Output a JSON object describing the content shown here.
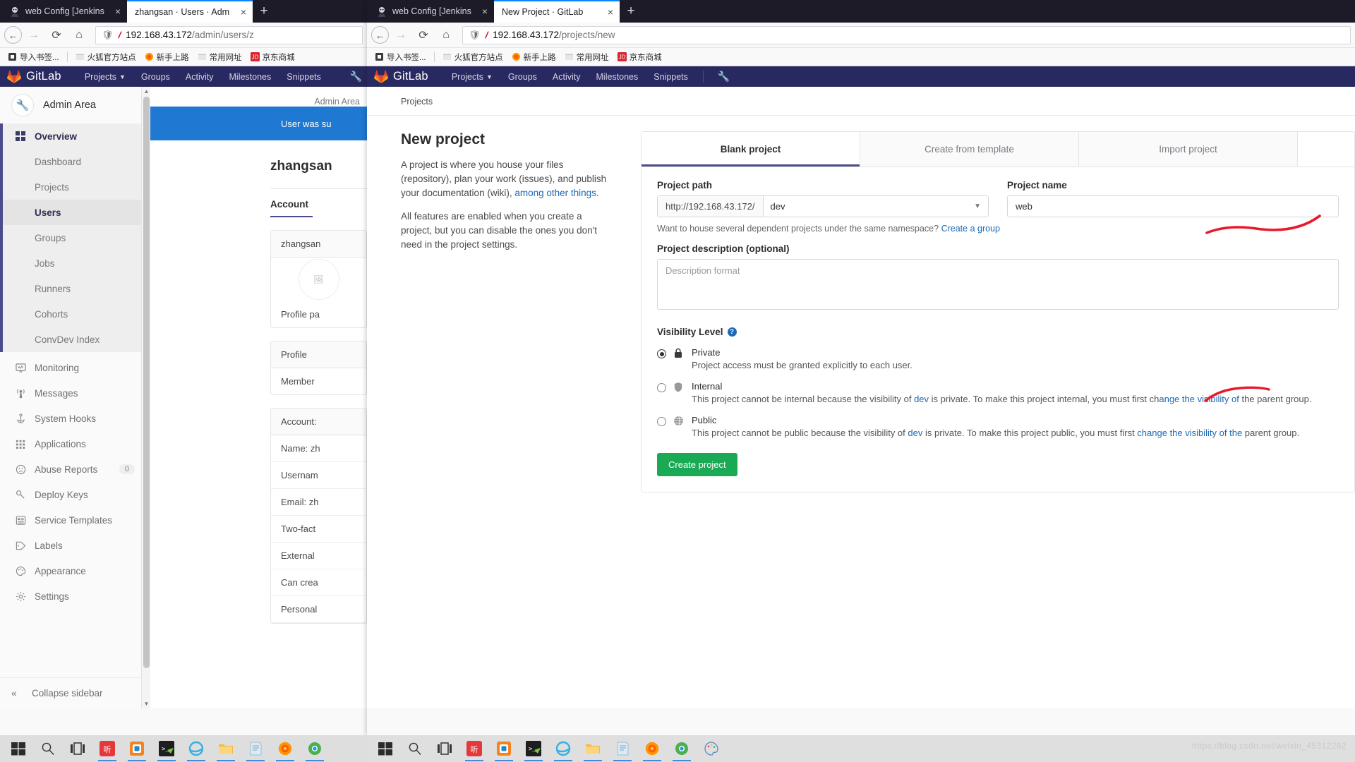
{
  "window1": {
    "tabs": [
      {
        "label": "web Config [Jenkins]",
        "favicon": "jenkins-icon",
        "active": false,
        "close": "×"
      },
      {
        "label": "zhangsan · Users · Admin Area · G",
        "favicon": "gitlab-icon",
        "active": true,
        "close": "×"
      }
    ],
    "newtab_label": "+",
    "url": "192.168.43.172",
    "url_path": "/admin/users/z",
    "nav": {
      "back": "←",
      "forward": "→",
      "reload": "⟳",
      "home": "⌂"
    },
    "bookmarks": [
      {
        "label": "导入书签...",
        "icon": "import-bookmarks-icon"
      },
      {
        "label": "火狐官方站点",
        "icon": "folder-icon"
      },
      {
        "label": "新手上路",
        "icon": "firefox-icon"
      },
      {
        "label": "常用网址",
        "icon": "folder-icon"
      },
      {
        "label": "京东商城",
        "icon": "jd-icon"
      }
    ],
    "gitlab_nav": {
      "brand": "GitLab",
      "items": [
        "Projects",
        "Groups",
        "Activity",
        "Milestones",
        "Snippets"
      ],
      "wrench": "wrench-icon"
    },
    "sidebar": {
      "title": "Admin Area",
      "avatar_icon": "wrench-icon",
      "overview": {
        "label": "Overview",
        "icon": "grid-icon"
      },
      "sub_items": [
        {
          "label": "Dashboard",
          "active": false
        },
        {
          "label": "Projects",
          "active": false
        },
        {
          "label": "Users",
          "active": true
        },
        {
          "label": "Groups",
          "active": false
        },
        {
          "label": "Jobs",
          "active": false
        },
        {
          "label": "Runners",
          "active": false
        },
        {
          "label": "Cohorts",
          "active": false
        },
        {
          "label": "ConvDev Index",
          "active": false
        }
      ],
      "items": [
        {
          "label": "Monitoring",
          "icon": "monitor-icon",
          "badge": ""
        },
        {
          "label": "Messages",
          "icon": "broadcast-icon",
          "badge": ""
        },
        {
          "label": "System Hooks",
          "icon": "hook-icon",
          "badge": ""
        },
        {
          "label": "Applications",
          "icon": "apps-icon",
          "badge": ""
        },
        {
          "label": "Abuse Reports",
          "icon": "frown-icon",
          "badge": "0"
        },
        {
          "label": "Deploy Keys",
          "icon": "key-icon",
          "badge": ""
        },
        {
          "label": "Service Templates",
          "icon": "template-icon",
          "badge": ""
        },
        {
          "label": "Labels",
          "icon": "label-icon",
          "badge": ""
        },
        {
          "label": "Appearance",
          "icon": "appearance-icon",
          "badge": ""
        },
        {
          "label": "Settings",
          "icon": "gear-icon",
          "badge": ""
        }
      ],
      "collapse": {
        "label": "Collapse sidebar",
        "icon": "chevrons-left-icon"
      }
    },
    "page": {
      "breadcrumb": "Admin Area",
      "flash": "User was su",
      "title": "zhangsan",
      "tab": "Account",
      "card1_header": "zhangsan",
      "card1_footer": "Profile pa",
      "card2_rows": [
        "Profile",
        "Member"
      ],
      "card3_header": "Account:",
      "card3_rows": [
        "Name: zh",
        "Usernam",
        "Email: zh",
        "Two-fact",
        "External",
        "Can crea",
        "Personal"
      ]
    }
  },
  "window2": {
    "tabs": [
      {
        "label": "web Config [Jenkins]",
        "favicon": "jenkins-icon",
        "active": false,
        "close": "×"
      },
      {
        "label": "New Project · GitLab",
        "favicon": "gitlab-icon",
        "active": true,
        "close": "×"
      }
    ],
    "newtab_label": "+",
    "url": "192.168.43.172",
    "url_path": "/projects/new",
    "nav": {
      "back": "←",
      "forward": "→",
      "reload": "⟳",
      "home": "⌂"
    },
    "bookmarks": [
      {
        "label": "导入书签...",
        "icon": "import-bookmarks-icon"
      },
      {
        "label": "火狐官方站点",
        "icon": "folder-icon"
      },
      {
        "label": "新手上路",
        "icon": "firefox-icon"
      },
      {
        "label": "常用网址",
        "icon": "folder-icon"
      },
      {
        "label": "京东商城",
        "icon": "jd-icon"
      }
    ],
    "gitlab_nav": {
      "brand": "GitLab",
      "items": [
        "Projects",
        "Groups",
        "Activity",
        "Milestones",
        "Snippets"
      ],
      "wrench": "wrench-icon"
    },
    "page": {
      "breadcrumb": "Projects",
      "title": "New project",
      "intro_p1_a": "A project is where you house your files (repository), plan your work (issues), and publish your documentation (wiki), ",
      "intro_p1_link": "among other things",
      "intro_p1_b": ".",
      "intro_p2": "All features are enabled when you create a project, but you can disable the ones you don't need in the project settings.",
      "tabs": [
        {
          "label": "Blank project",
          "active": true
        },
        {
          "label": "Create from template",
          "active": false
        },
        {
          "label": "Import project",
          "active": false
        }
      ],
      "project_path": {
        "label": "Project path",
        "prefix": "http://192.168.43.172/",
        "value": "dev",
        "chevron": "chevron-down-icon"
      },
      "project_name": {
        "label": "Project name",
        "value": "web"
      },
      "namespace_hint_text": "Want to house several dependent projects under the same namespace? ",
      "namespace_hint_link": "Create a group",
      "description": {
        "label": "Project description (optional)",
        "placeholder": "Description format"
      },
      "visibility": {
        "label": "Visibility Level",
        "help": "?",
        "options": [
          {
            "name": "Private",
            "icon": "lock-icon",
            "selected": true,
            "desc_parts": [
              "Project access must be granted explicitly to each user."
            ]
          },
          {
            "name": "Internal",
            "icon": "shield-icon",
            "selected": false,
            "desc_parts": [
              "This project cannot be internal because the visibility of ",
              "dev",
              " is private. To make this project internal, you must first ch",
              "the parent group."
            ]
          },
          {
            "name": "Public",
            "icon": "globe-icon",
            "selected": false,
            "desc_parts": [
              "This project cannot be public because the visibility of ",
              "dev",
              " is private. To make this project public, you must first ",
              "chan",
              "parent group."
            ]
          }
        ]
      },
      "submit": "Create project"
    }
  },
  "taskbar": {
    "left": {
      "start": "windows-start-icon",
      "search": "search-icon",
      "taskview": "task-view-icon",
      "apps": [
        "kugou-icon",
        "wps-icon",
        "terminal-icon",
        "ie-icon",
        "explorer-icon",
        "notepad-icon",
        "firefox-icon",
        "chrome-icon"
      ]
    },
    "right": {
      "start": "windows-start-icon",
      "search": "search-icon",
      "taskview": "task-view-icon",
      "apps": [
        "kugou-icon",
        "wps-icon",
        "terminal-icon",
        "ie-icon",
        "explorer-icon",
        "notepad-icon",
        "firefox-icon",
        "chrome-icon",
        "paint-icon"
      ]
    }
  },
  "watermark": "https://blog.csdn.net/weixin_45312262"
}
